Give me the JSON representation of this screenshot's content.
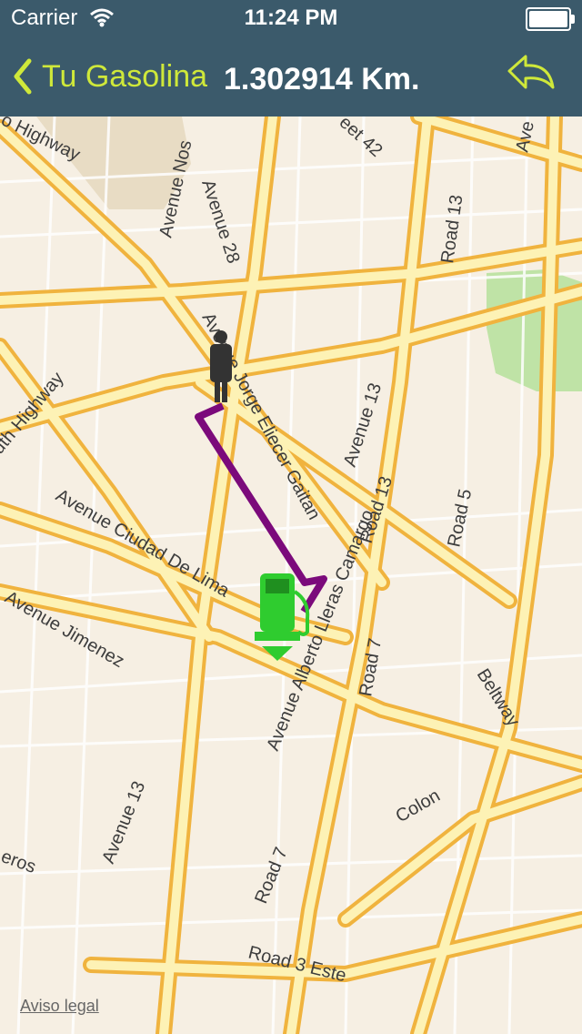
{
  "status_bar": {
    "carrier": "Carrier",
    "time": "11:24 PM"
  },
  "nav": {
    "back_label": "Tu Gasolina",
    "title": "1.302914 Km."
  },
  "map": {
    "legal_link": "Aviso legal",
    "road_labels": [
      "Avenue Jorge Eliecer Gaitan",
      "Avenue 28",
      "Avenue Nos",
      "Avenue 13",
      "Road 13",
      "Road 5",
      "Avenue Ciudad De Lima",
      "Avenue Jimenez",
      "Avenue Alberto Lleras Camargo",
      "Road 7",
      "Beltway",
      "Colon",
      "Road 3 Este",
      "uth Highway",
      "o Highway",
      "eet 42",
      "eros"
    ],
    "route_color": "#7b0a7b",
    "road_color": "#f4c24a",
    "park_color": "#bfe3a6"
  },
  "colors": {
    "navbar": "#3b5a6b",
    "accent": "#cfe83a"
  }
}
